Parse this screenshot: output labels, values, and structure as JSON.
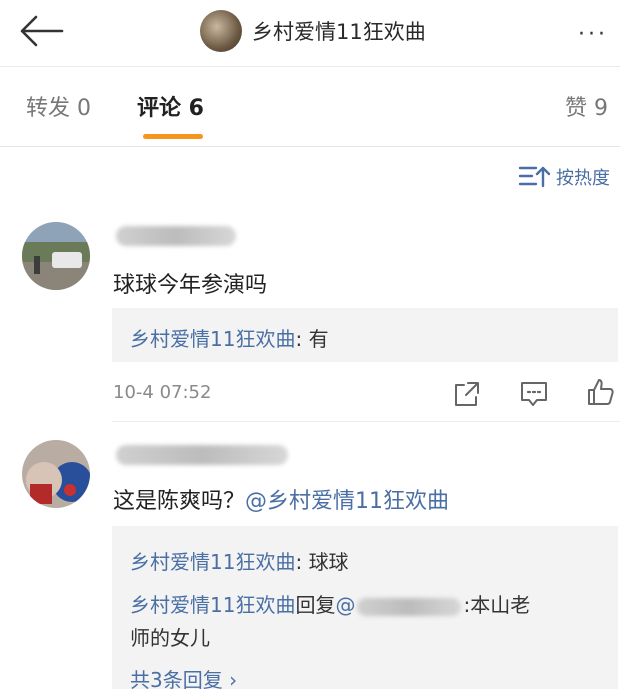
{
  "header": {
    "title": "乡村爱情11狂欢曲",
    "more": "···"
  },
  "tabs": [
    {
      "label": "转发 0"
    },
    {
      "label": "评论 6"
    },
    {
      "label": "赞 9"
    }
  ],
  "sort": {
    "label": "按热度"
  },
  "comments": [
    {
      "text": "球球今年参演吗",
      "replies": [
        {
          "author": "乡村爱情11狂欢曲",
          "sep": ": ",
          "text": "有"
        }
      ],
      "time": "10-4 07:52"
    },
    {
      "text": "这是陈爽吗？",
      "mention": "@乡村爱情11狂欢曲",
      "replies": [
        {
          "author": "乡村爱情11狂欢曲",
          "sep": ": ",
          "text": "球球"
        },
        {
          "author": "乡村爱情11狂欢曲",
          "mid": "回复",
          "at": "@",
          "tail": ":本山老",
          "tail2": "师的女儿"
        }
      ],
      "more_replies": "共3条回复 ›"
    }
  ]
}
